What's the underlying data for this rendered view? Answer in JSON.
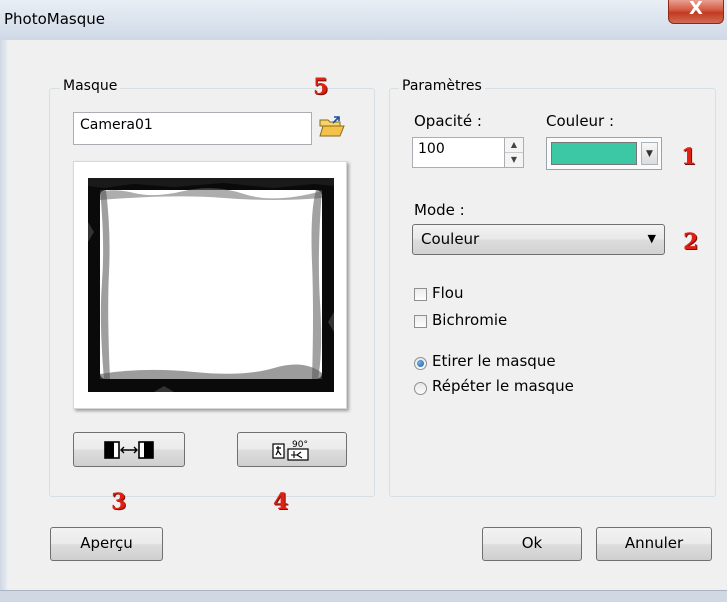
{
  "window": {
    "title": "PhotoMasque",
    "close_label": "X"
  },
  "masque": {
    "group_label": "Masque",
    "file_value": "Camera01"
  },
  "parametres": {
    "group_label": "Paramètres",
    "opacite_label": "Opacité :",
    "opacite_value": "100",
    "couleur_label": "Couleur :",
    "couleur_hex": "#3cc8a4",
    "mode_label": "Mode :",
    "mode_value": "Couleur",
    "flou_label": "Flou",
    "flou_checked": false,
    "bichromie_label": "Bichromie",
    "bichromie_checked": false,
    "etirer_label": "Etirer le masque",
    "repeter_label": "Répéter le masque",
    "selected_option": "Etirer le masque"
  },
  "buttons": {
    "apercu": "Aperçu",
    "ok": "Ok",
    "annuler": "Annuler"
  },
  "annotations": {
    "m1": "1",
    "m2": "2",
    "m3": "3",
    "m4": "4",
    "m5": "5"
  },
  "icons": {
    "open_folder": "open-folder-icon",
    "flip": "flip-icon",
    "rotate": "rotate-90-icon"
  }
}
